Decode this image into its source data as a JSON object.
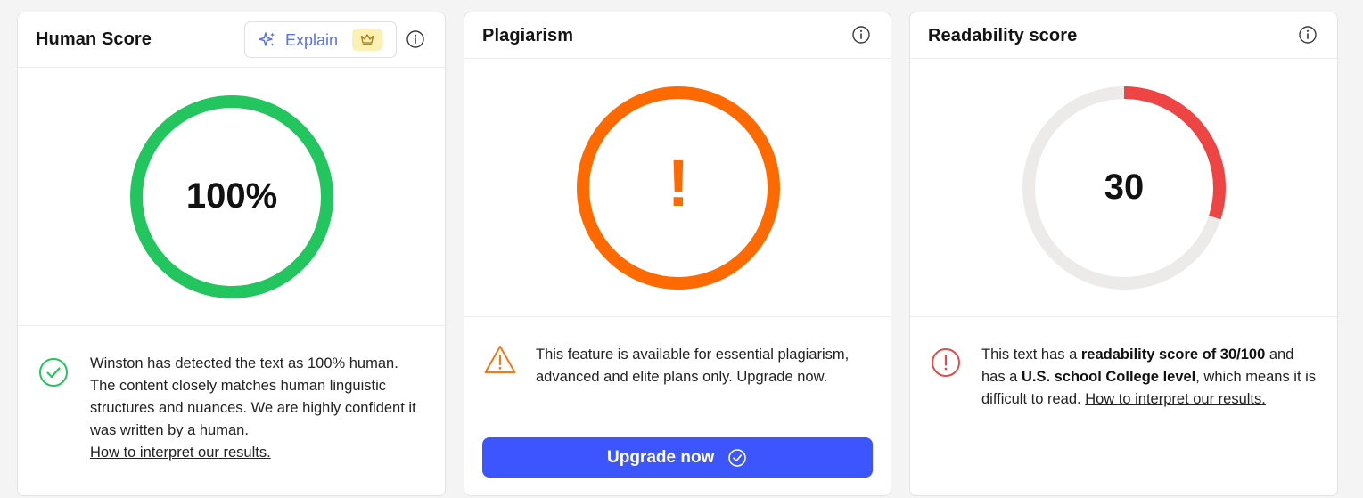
{
  "human_score": {
    "title": "Human Score",
    "explain_label": "Explain",
    "score_text": "100%",
    "score_value": 100,
    "ring_color": "#22c55e",
    "message_text": "Winston has detected the text as 100% human. The content closely matches human linguistic structures and nuances. We are highly confident it was written by a human.",
    "link_text": "How to interpret our results.",
    "icons": [
      "sparkle-icon",
      "crown-icon",
      "info-icon",
      "check-circle-icon"
    ]
  },
  "plagiarism": {
    "title": "Plagiarism",
    "alert_mark": "!",
    "ring_color": "#ff6a00",
    "message_text": "This feature is available for essential plagiarism, advanced and elite plans only. Upgrade now.",
    "upgrade_label": "Upgrade now",
    "button_color": "#3d55ff",
    "icons": [
      "info-icon",
      "warning-triangle-icon",
      "check-circle-icon"
    ]
  },
  "readability": {
    "title": "Readability score",
    "score_text": "30",
    "score_value": 30,
    "ring_color": "#ef4444",
    "track_color": "#ecebea",
    "message_prefix": "This text has a ",
    "message_bold_1": "readability score of 30/100",
    "message_mid": " and has a ",
    "message_bold_2": "U.S. school College level",
    "message_suffix": ", which means it is difficult to read. ",
    "link_text": "How to interpret our results.",
    "icons": [
      "info-icon",
      "alert-circle-icon"
    ]
  }
}
